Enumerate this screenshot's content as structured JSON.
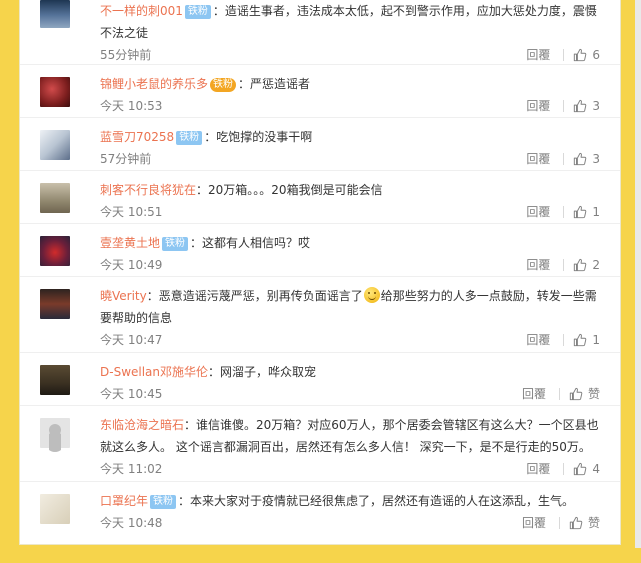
{
  "actions": {
    "reply_label": "回覆",
    "like_icon": "thumbs-up-icon"
  },
  "comments": [
    {
      "user": "不一样的刺001",
      "badge": "铁粉",
      "badge_style": "blue",
      "text": "造谣生事者，违法成本太低，起不到警示作用，应加大惩处力度，震慑不法之徒",
      "time": "55分钟前",
      "likes": "6"
    },
    {
      "user": "锦鲤小老鼠的养乐多",
      "badge": "铁粉",
      "badge_style": "gold",
      "text": "严惩造谣者",
      "time": "今天 10:53",
      "likes": "3"
    },
    {
      "user": "蓝雪刀70258",
      "badge": "铁粉",
      "badge_style": "blue",
      "text": "吃饱撑的没事干啊",
      "time": "57分钟前",
      "likes": "3"
    },
    {
      "user": "刺客不行良将犹在",
      "badge": "",
      "badge_style": "",
      "text": "20万箱。。。20箱我倒是可能会信",
      "time": "今天 10:51",
      "likes": "1"
    },
    {
      "user": "壹垄黄土地",
      "badge": "铁粉",
      "badge_style": "blue",
      "text": "这都有人相信吗？哎",
      "time": "今天 10:49",
      "likes": "2"
    },
    {
      "user": "曉Verity",
      "badge": "",
      "badge_style": "",
      "text_before": "恶意造谣污蔑严惩，别再传负面谣言了",
      "emoji": "smile-emoji-icon",
      "text_after": "给那些努力的人多一点鼓励，转发一些需要帮助的信息",
      "time": "今天 10:47",
      "likes": "1"
    },
    {
      "user": "D-Swellan邓施华伦",
      "badge": "",
      "badge_style": "",
      "text": "网溜子，哗众取宠",
      "time": "今天 10:45",
      "likes": "赞"
    },
    {
      "user": "东临沧海之暗石",
      "badge": "",
      "badge_style": "",
      "text": "谁信谁傻。20万箱？对应60万人，那个居委会管辖区有这么大？一个区县也就这么多人。 这个谣言都漏洞百出，居然还有怎么多人信！ 深究一下，是不是行走的50万。",
      "time": "今天 11:02",
      "likes": "4"
    },
    {
      "user": "口罩纪年",
      "badge": "铁粉",
      "badge_style": "blue",
      "text": "本来大家对于疫情就已经很焦虑了，居然还有造谣的人在这添乱，生气。",
      "time": "今天 10:48",
      "likes": "赞"
    }
  ]
}
